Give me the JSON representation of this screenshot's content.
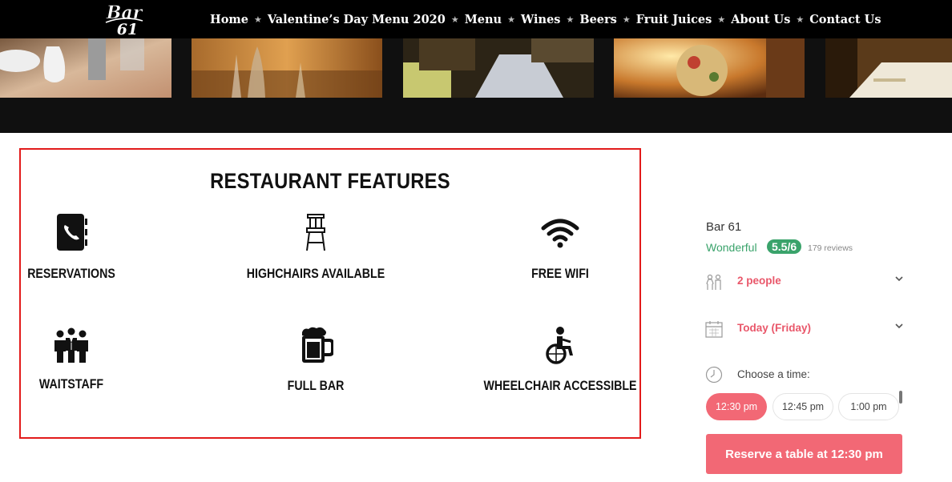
{
  "header": {
    "logo_text_top": "Bar",
    "logo_text_bottom": "61",
    "nav": [
      {
        "label": "Home"
      },
      {
        "label": "Valentine’s Day Menu 2020"
      },
      {
        "label": "Menu"
      },
      {
        "label": "Wines"
      },
      {
        "label": "Beers"
      },
      {
        "label": "Fruit Juices"
      },
      {
        "label": "About Us"
      },
      {
        "label": "Contact Us"
      }
    ]
  },
  "features": {
    "title": "RESTAURANT FEATURES",
    "items": [
      {
        "label": "RESERVATIONS",
        "icon": "phone-book-icon"
      },
      {
        "label": "HIGHCHAIRS AVAILABLE",
        "icon": "highchair-icon"
      },
      {
        "label": "FREE WIFI",
        "icon": "wifi-icon"
      },
      {
        "label": "WAITSTAFF",
        "icon": "waitstaff-icon"
      },
      {
        "label": "FULL BAR",
        "icon": "beer-mug-icon"
      },
      {
        "label": "WHEELCHAIR ACCESSIBLE",
        "icon": "wheelchair-icon"
      }
    ]
  },
  "booking": {
    "restaurant_name": "Bar 61",
    "rating_text": "Wonderful",
    "score": "5.5/6",
    "reviews": "179 reviews",
    "party_size": "2 people",
    "date": "Today (Friday)",
    "time_prompt": "Choose a time:",
    "slots": [
      "12:30 pm",
      "12:45 pm",
      "1:00 pm"
    ],
    "selected_slot": "12:30 pm",
    "reserve_label": "Reserve a table at 12:30 pm",
    "colors": {
      "accent": "#f26875",
      "rating": "#3aa36b",
      "highlight_border": "#e21b1b"
    }
  }
}
